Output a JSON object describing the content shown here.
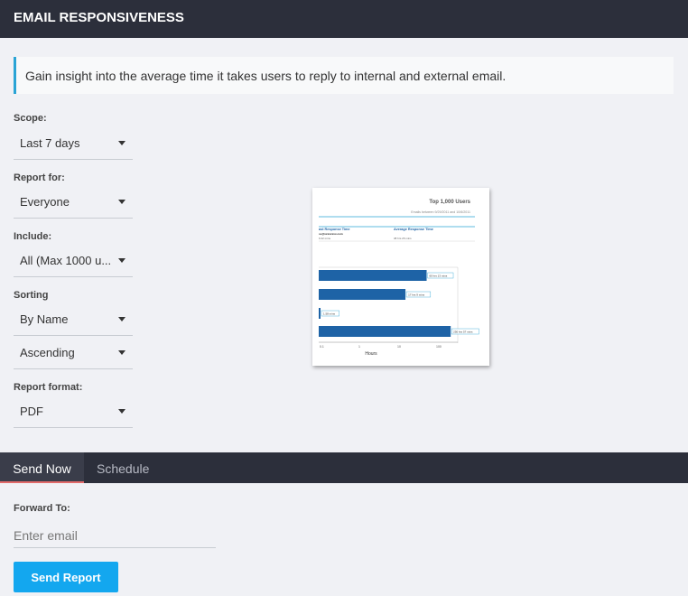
{
  "header": {
    "title": "EMAIL RESPONSIVENESS"
  },
  "info": {
    "text": "Gain insight into the average time it takes users to reply to internal and external email."
  },
  "form": {
    "scope": {
      "label": "Scope:",
      "value": "Last 7 days"
    },
    "report_for": {
      "label": "Report for:",
      "value": "Everyone"
    },
    "include": {
      "label": "Include:",
      "value": "All (Max 1000 u..."
    },
    "sorting": {
      "label": "Sorting",
      "value": "By Name",
      "order": "Ascending"
    },
    "report_format": {
      "label": "Report format:",
      "value": "PDF"
    }
  },
  "preview": {
    "title": "Top 1,000 Users",
    "subtitle": "Emails between 9/29/2011 and 10/6/2011",
    "col1_header": "ast Response Time",
    "col1_email": "ss@xxxxxxxx.com",
    "col1_value": "9.42 mins",
    "col2_header": "Average Response Time",
    "col2_value": "38 hrs 26 mins",
    "bar_labels": [
      "60 hrs 13 mins",
      "17 hrs 9 mins",
      "1.58 mins",
      "250 hrs 57 mins"
    ],
    "bar_values_hours": [
      60.2,
      17.15,
      0.026,
      250.95
    ],
    "axis_ticks": [
      "0.1",
      "1",
      "10",
      "100"
    ],
    "axis_label": "Hours",
    "colors": {
      "bar": "#1e63a6",
      "rule": "#2aa4d5"
    }
  },
  "tabs": {
    "send_now": "Send Now",
    "schedule": "Schedule"
  },
  "forward": {
    "label": "Forward To:",
    "placeholder": "Enter email"
  },
  "send_button": "Send Report"
}
